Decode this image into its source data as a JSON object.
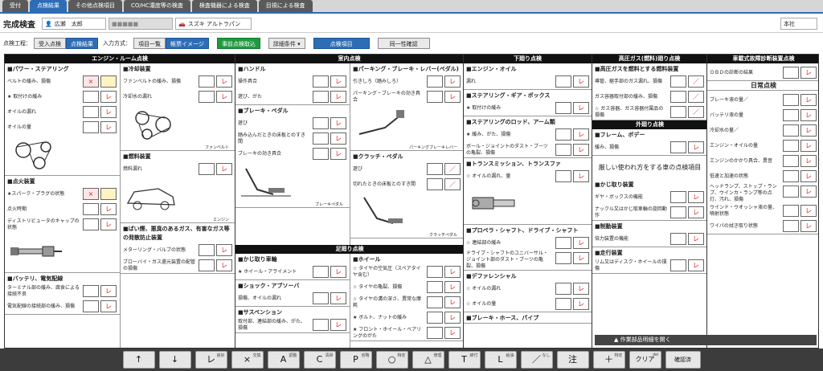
{
  "tabs": [
    "受付",
    "点検結果",
    "その他点検項目",
    "CO/HC濃度等の検査",
    "検査機器による検査",
    "目視による検査"
  ],
  "header": {
    "title": "完成検査",
    "owner": "広瀬　太郎",
    "plate": "■■■■■",
    "car": "スズキ アルトラパン",
    "store": "本社"
  },
  "controls": {
    "process_label": "点検工程：",
    "process": [
      "受入点検",
      "点検結果"
    ],
    "input_label": "入力方式：",
    "input": [
      "項目一覧",
      "帳票イメージ"
    ],
    "prefetch": "事前点検取込",
    "detail": "詳細条件 ▾",
    "check_items": "点検項目",
    "same": "同一性確認"
  },
  "panes": {
    "engine": {
      "title": "エンジン・ルーム点検",
      "left": [
        {
          "title": "■パワー・ステアリング",
          "rows": [
            {
              "text": "ベルトの緩み、損傷",
              "marks": [
                "×",
                ""
              ]
            },
            {
              "text": "★ 取付けの緩み",
              "marks": [
                "",
                "レ"
              ]
            },
            {
              "text": "オイルの漏れ",
              "marks": [
                "",
                "レ"
              ]
            },
            {
              "text": "オイルの量",
              "marks": [
                "",
                "レ"
              ]
            }
          ],
          "icon": "belt-diagram-icon"
        },
        {
          "title": "■点火装置",
          "rows": [
            {
              "text": "★スパーク・プラグの状態",
              "marks": [
                "×",
                ""
              ]
            },
            {
              "text": "点火時期",
              "marks": [
                "",
                "レ"
              ]
            },
            {
              "text": "ディストリビュータのキャップの状態",
              "marks": [
                "",
                "レ"
              ]
            }
          ],
          "icon": "spark-plug-icon"
        },
        {
          "title": "■バッテリ、電気配線",
          "rows": [
            {
              "text": "ターミナル部の緩み、腐食による接続不良",
              "marks": [
                "",
                "レ"
              ]
            },
            {
              "text": "電気配線の接続部の緩み、損傷",
              "marks": [
                "",
                "レ"
              ]
            }
          ]
        }
      ],
      "right": [
        {
          "title": "■冷却装置",
          "rows": [
            {
              "text": "ファンベルトの緩み、損傷",
              "marks": [
                "",
                "レ"
              ]
            },
            {
              "text": "冷却水の漏れ",
              "marks": [
                "",
                "レ"
              ]
            }
          ],
          "icon": "fan-belt-icon",
          "note": "ファンベルト"
        },
        {
          "title": "■燃料装置",
          "rows": [
            {
              "text": "燃料漏れ",
              "marks": [
                "",
                "レ"
              ]
            }
          ],
          "icon": "engine-car-icon",
          "note": "エンジン"
        },
        {
          "title": "■ばい煙、悪臭のあるガス、有害なガス等の発散防止装置",
          "rows": [
            {
              "text": "メターリング・バルブの状態",
              "marks": [
                "",
                "レ"
              ]
            },
            {
              "text": "ブローバイ・ガス還元装置の配管の損傷",
              "marks": [
                "",
                "レ"
              ]
            }
          ]
        }
      ]
    },
    "cabin": {
      "title": "室内点検",
      "left": [
        {
          "title": "■ハンドル",
          "rows": [
            {
              "text": "操作具合",
              "marks": [
                "",
                "レ"
              ]
            },
            {
              "text": "遊び、がた",
              "marks": [
                "",
                "レ"
              ]
            }
          ]
        },
        {
          "title": "■ブレーキ・ペダル",
          "rows": [
            {
              "text": "遊び",
              "marks": [
                "",
                "レ"
              ]
            },
            {
              "text": "踏み込んだときの床板とのすき間",
              "marks": [
                "",
                "レ"
              ]
            },
            {
              "text": "ブレーキの効き具合",
              "marks": [
                "",
                "レ"
              ]
            }
          ],
          "icon": "brake-pedal-icon",
          "note": "ブレーキペダル"
        }
      ],
      "right": [
        {
          "title": "■パーキング・ブレーキ・レバー(ペダル)",
          "rows": [
            {
              "text": "引きしろ（踏みしろ）",
              "marks": [
                "",
                "レ"
              ]
            },
            {
              "text": "パーキング・ブレーキの効き具合",
              "marks": [
                "",
                "レ"
              ]
            }
          ],
          "icon": "parking-brake-icon",
          "note": "パーキングブレーキレバー"
        },
        {
          "title": "■クラッチ・ペダル",
          "rows": [
            {
              "text": "遊び",
              "marks": [
                "",
                "／"
              ]
            },
            {
              "text": "切れたときの床板とのすき間",
              "marks": [
                "",
                "／"
              ]
            }
          ],
          "icon": "clutch-pedal-icon",
          "note": "クラッチペダル"
        }
      ]
    },
    "suspension": {
      "title": "足廻り点検",
      "left": [
        {
          "title": "■かじ取り車輪",
          "rows": [
            {
              "text": "★ ホイール・アライメント",
              "marks": [
                "",
                "レ"
              ]
            }
          ]
        },
        {
          "title": "■ショック・アブソーバ",
          "rows": [
            {
              "text": "損傷、オイルの漏れ",
              "marks": [
                "",
                "レ"
              ]
            }
          ]
        },
        {
          "title": "■サスペンション",
          "rows": [
            {
              "text": "取付部、連結部の緩み、がた、損傷",
              "marks": [
                "",
                "レ"
              ]
            }
          ]
        }
      ],
      "right": [
        {
          "title": "■ホイール",
          "rows": [
            {
              "text": "☆ タイヤの空気圧（スペアタイヤ含む）",
              "marks": [
                "",
                "レ"
              ]
            },
            {
              "text": "☆ タイヤの亀裂、損傷",
              "marks": [
                "",
                "レ"
              ]
            },
            {
              "text": "☆ タイヤの溝の深さ、異常な摩耗",
              "marks": [
                "",
                "レ"
              ]
            },
            {
              "text": "★ ボルト、ナットの緩み",
              "marks": [
                "",
                "レ"
              ]
            },
            {
              "text": "★ フロント・ホイール・ベアリングのがた",
              "marks": [
                "",
                "レ"
              ]
            }
          ]
        }
      ]
    },
    "under": {
      "title": "下廻り点検",
      "left": [
        {
          "title": "■エンジン・オイル",
          "rows": [
            {
              "text": "漏れ",
              "marks": [
                "",
                "レ"
              ]
            }
          ]
        },
        {
          "title": "■ステアリング・ギア・ボックス",
          "rows": [
            {
              "text": "★ 取付けの緩み",
              "marks": [
                "",
                "レ"
              ]
            }
          ]
        },
        {
          "title": "■ステアリングのロッド、アーム類",
          "rows": [
            {
              "text": "★ 緩み、がた、損傷",
              "marks": [
                "",
                "レ"
              ]
            },
            {
              "text": "ボール・ジョイントのダスト・ブーツの亀裂、損傷",
              "marks": [
                "",
                "レ"
              ]
            }
          ]
        },
        {
          "title": "■トランスミッション、トランスファ",
          "rows": [
            {
              "text": "☆ オイルの漏れ、量",
              "marks": [
                "",
                "レ"
              ]
            }
          ],
          "icon": "transmission-icon"
        },
        {
          "title": "■プロペラ・シャフト、ドライブ・シャフト",
          "rows": [
            {
              "text": "☆ 連結部の緩み",
              "marks": [
                "",
                "レ"
              ]
            },
            {
              "text": "ドライブ・シャフトのユニバーサル・ジョイント部のダスト・ブーツの亀裂、損傷",
              "marks": [
                "",
                "レ"
              ]
            }
          ]
        },
        {
          "title": "■デファレンシャル",
          "rows": [
            {
              "text": "☆ オイルの漏れ",
              "marks": [
                "",
                "レ"
              ]
            },
            {
              "text": "☆ オイルの量",
              "marks": [
                "",
                "レ"
              ]
            }
          ]
        },
        {
          "title": "■ブレーキ・ホース、パイプ",
          "rows": []
        }
      ]
    },
    "gas": {
      "title": "高圧ガス(燃料)廻り点検",
      "sections": [
        {
          "title": "■高圧ガスを燃料とする燃料装置",
          "rows": [
            {
              "text": "導管、継手部のガス漏れ、損傷",
              "marks": [
                "",
                "／"
              ]
            },
            {
              "text": "ガス容器取付部の緩み、損傷",
              "marks": [
                "",
                "／"
              ]
            },
            {
              "text": "☆ ガス容器、ガス容器付属品の損傷",
              "marks": [
                "",
                "／"
              ]
            }
          ]
        }
      ],
      "outer_title": "外廻り点検",
      "outer": [
        {
          "title": "■フレーム、ボデー",
          "rows": [
            {
              "text": "緩み、損傷",
              "marks": [
                "",
                "レ"
              ]
            }
          ]
        }
      ],
      "message": "厳しい使われ方をする車の点検項目",
      "more": [
        {
          "title": "■かじ取り装置",
          "rows": [
            {
              "text": "ギヤ・ボックスの機能",
              "marks": [
                "",
                "レ"
              ]
            },
            {
              "text": "ナックル又はかじ取車輪の旋回動作",
              "marks": [
                "",
                "レ"
              ]
            }
          ]
        },
        {
          "title": "■制動装置",
          "rows": [
            {
              "text": "倍力装置の機能",
              "marks": [
                "",
                "レ"
              ]
            }
          ]
        },
        {
          "title": "■走行装置",
          "rows": [
            {
              "text": "リム又はディスク・ホイールの損傷",
              "marks": [
                "",
                "レ"
              ]
            }
          ]
        }
      ]
    },
    "diag": {
      "title": "車載式故障診断装置点検",
      "rows": [
        {
          "text": "ＯＢＤの診断の結果",
          "marks": [
            "",
            "レ"
          ]
        }
      ],
      "daily_title": "日常点検",
      "daily": [
        {
          "text": "ブレーキ液の量／",
          "marks": [
            "",
            "レ"
          ]
        },
        {
          "text": "バッテリ液の量",
          "marks": [
            "",
            "レ"
          ]
        },
        {
          "text": "冷却水の量／",
          "marks": [
            "",
            "レ"
          ]
        },
        {
          "text": "エンジン・オイルの量",
          "marks": [
            "",
            "レ"
          ]
        },
        {
          "text": "エンジンのかかり具合、異音",
          "marks": [
            "",
            "レ"
          ]
        },
        {
          "text": "低速と加速の状態",
          "marks": [
            "",
            "レ"
          ]
        },
        {
          "text": "ヘッドランプ、ストップ・ランプ、ウインカ・ランプ等の点灯、汚れ、損傷",
          "marks": [
            "",
            "レ"
          ]
        },
        {
          "text": "ウインド・ウオッシャ液の量、噴射状態",
          "marks": [
            "",
            "レ"
          ]
        },
        {
          "text": "ワイパの拭き取り状態",
          "marks": [
            "",
            "レ"
          ]
        }
      ]
    }
  },
  "detail_bar": "作業部品明細を開く",
  "toolbar": [
    {
      "glyph": "↑",
      "sub": ""
    },
    {
      "glyph": "↓",
      "sub": ""
    },
    {
      "glyph": "レ",
      "sub": "良好"
    },
    {
      "glyph": "×",
      "sub": "交換"
    },
    {
      "glyph": "A",
      "sub": "調整"
    },
    {
      "glyph": "C",
      "sub": "清掃"
    },
    {
      "glyph": "P",
      "sub": "省略"
    },
    {
      "glyph": "○",
      "sub": "特定"
    },
    {
      "glyph": "△",
      "sub": "修理"
    },
    {
      "glyph": "T",
      "sub": "締付"
    },
    {
      "glyph": "L",
      "sub": "給油"
    },
    {
      "glyph": "／",
      "sub": "なし"
    },
    {
      "glyph": "注",
      "sub": ""
    },
    {
      "glyph": "＋",
      "sub": "特定"
    },
    {
      "glyph": "クリア",
      "sub": "del"
    },
    {
      "glyph": "確認済",
      "sub": ""
    }
  ]
}
